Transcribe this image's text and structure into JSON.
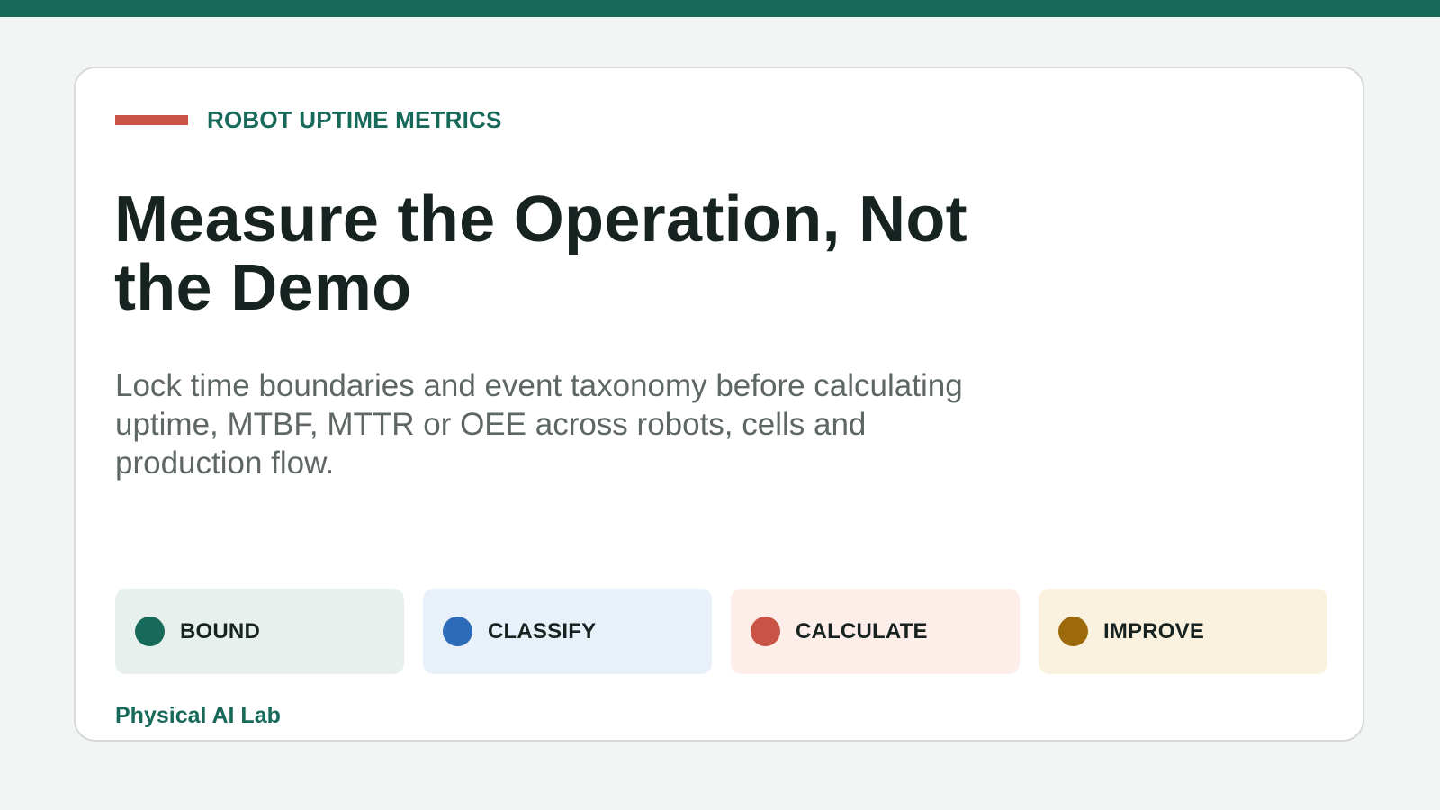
{
  "theme": {
    "top_bar_color": "#17695a",
    "accent_rule_color": "#c95446",
    "brand_color": "#17695a"
  },
  "header": {
    "eyebrow": "ROBOT UPTIME METRICS",
    "title": "Measure the Operation, Not the Demo",
    "subtitle": "Lock time boundaries and event taxonomy before calculating uptime, MTBF, MTTR or OEE across robots, cells and production flow."
  },
  "steps": [
    {
      "label": "BOUND",
      "dot_color": "#17695a",
      "bg_color": "#e7f0ed"
    },
    {
      "label": "CLASSIFY",
      "dot_color": "#2c6bb8",
      "bg_color": "#e8f0fa"
    },
    {
      "label": "CALCULATE",
      "dot_color": "#c95446",
      "bg_color": "#fdeeea"
    },
    {
      "label": "IMPROVE",
      "dot_color": "#9c6a0a",
      "bg_color": "#faf2df"
    }
  ],
  "footer": {
    "label": "Physical AI Lab"
  }
}
